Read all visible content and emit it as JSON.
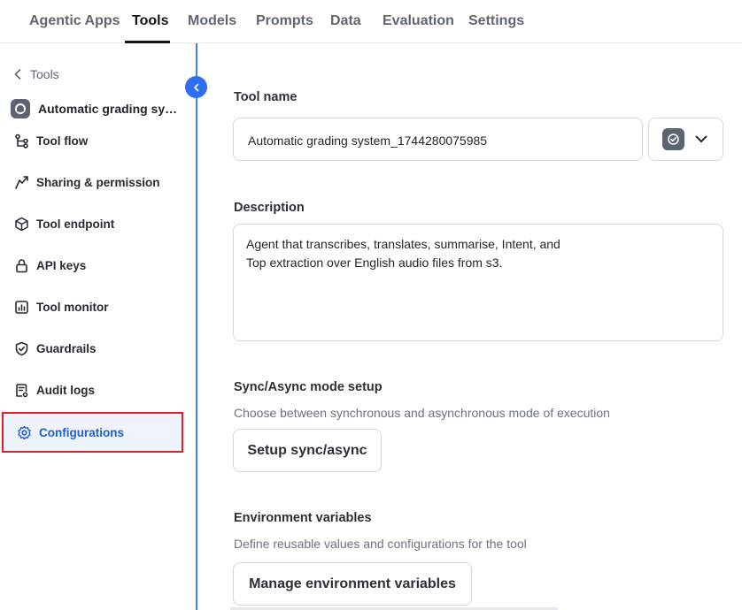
{
  "topnav": {
    "tabs": [
      {
        "label": "Agentic Apps"
      },
      {
        "label": "Tools"
      },
      {
        "label": "Models"
      },
      {
        "label": "Prompts"
      },
      {
        "label": "Data"
      },
      {
        "label": "Evaluation"
      },
      {
        "label": "Settings"
      }
    ],
    "active_tab": "Tools"
  },
  "sidebar": {
    "back_label": "Tools",
    "tool_title": "Automatic grading syste...",
    "items": [
      {
        "label": "Tool flow",
        "icon": "flow-icon"
      },
      {
        "label": "Sharing & permission",
        "icon": "share-icon"
      },
      {
        "label": "Tool endpoint",
        "icon": "cube-icon"
      },
      {
        "label": "API keys",
        "icon": "lock-icon"
      },
      {
        "label": "Tool monitor",
        "icon": "chart-icon"
      },
      {
        "label": "Guardrails",
        "icon": "shield-icon"
      },
      {
        "label": "Audit logs",
        "icon": "document-icon"
      },
      {
        "label": "Configurations",
        "icon": "gear-icon"
      }
    ],
    "selected_item": "Configurations"
  },
  "main": {
    "tool_name": {
      "label": "Tool name",
      "value": "Automatic grading system_1744280075985"
    },
    "description": {
      "label": "Description",
      "lines": [
        "Agent that transcribes, translates, summarise, Intent, and",
        "Top extraction over English audio files from s3."
      ]
    },
    "sync_async": {
      "label": "Sync/Async mode setup",
      "helper": "Choose between synchronous and asynchronous mode of execution",
      "button": "Setup sync/async"
    },
    "env_vars": {
      "label": "Environment variables",
      "helper": "Define reusable values and configurations for the tool",
      "button": "Manage environment variables"
    }
  },
  "colors": {
    "accent": "#2f6fed",
    "selected_bg": "#eef3fe",
    "highlight_border": "#e11d2a"
  }
}
